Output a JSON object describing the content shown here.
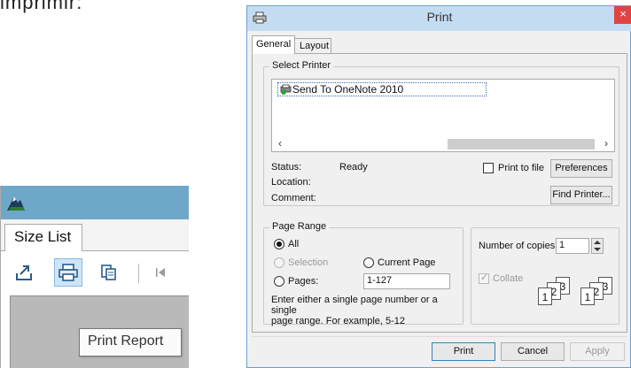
{
  "background_text": "imprimir:",
  "app": {
    "tab_label": "Size List",
    "tooltip": "Print Report",
    "colors": {
      "titlebar": "#6fa7c8",
      "canvas": "#b9b9b9"
    }
  },
  "dialog": {
    "title": "Print",
    "close_glyph": "×",
    "tabs": [
      "General",
      "Layout"
    ],
    "select_printer": {
      "legend": "Select Printer",
      "printers": [
        "Send To OneNote 2010"
      ],
      "scroll_left": "‹",
      "scroll_right": "›"
    },
    "status": {
      "status_label": "Status:",
      "status_value": "Ready",
      "location_label": "Location:",
      "comment_label": "Comment:",
      "print_to_file_label": "Print to file",
      "print_to_file_checked": false,
      "preferences_button": "Preferences",
      "find_printer_button": "Find Printer..."
    },
    "page_range": {
      "legend": "Page Range",
      "all_label": "All",
      "selection_label": "Selection",
      "current_page_label": "Current Page",
      "pages_label": "Pages:",
      "pages_value": "1-127",
      "selected": "All",
      "help_text_line1": "Enter either a single page number or a single",
      "help_text_line2": "page range.  For example, 5-12"
    },
    "copies": {
      "label": "Number of copies:",
      "value": "1",
      "collate_label": "Collate",
      "collate_checked": true,
      "collate_pages": [
        "1",
        "2",
        "3"
      ]
    },
    "buttons": {
      "print": "Print",
      "cancel": "Cancel",
      "apply": "Apply"
    },
    "colors": {
      "titlebar": "#c4dcf2",
      "close": "#e04343",
      "border": "#6e9fcf"
    }
  }
}
